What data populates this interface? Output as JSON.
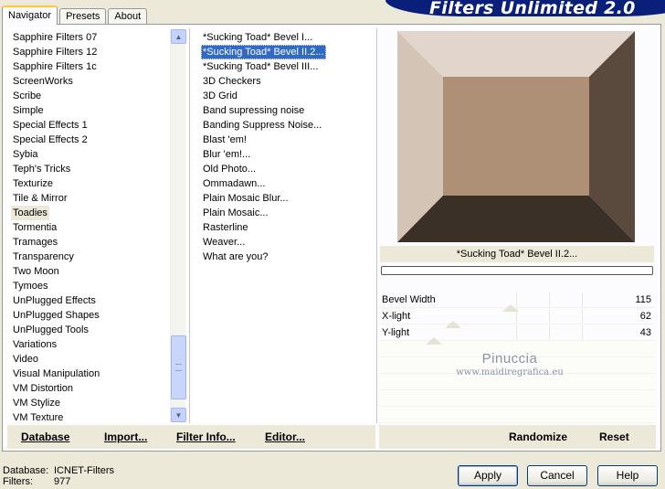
{
  "tabs": [
    "Navigator",
    "Presets",
    "About"
  ],
  "brand": "Filters Unlimited 2.0",
  "categories": [
    "Sapphire Filters 07",
    "Sapphire Filters 12",
    "Sapphire Filters 1c",
    "ScreenWorks",
    "Scribe",
    "Simple",
    "Special Effects 1",
    "Special Effects 2",
    "Sybia",
    "Teph's Tricks",
    "Texturize",
    "Tile & Mirror",
    "Toadies",
    "Tormentia",
    "Tramages",
    "Transparency",
    "Two Moon",
    "Tymoes",
    "UnPlugged Effects",
    "UnPlugged Shapes",
    "UnPlugged Tools",
    "Variations",
    "Video",
    "Visual Manipulation",
    "VM Distortion",
    "VM Stylize",
    "VM Texture"
  ],
  "selected_category": "Toadies",
  "filters": [
    "*Sucking Toad*  Bevel I...",
    "*Sucking Toad*  Bevel II.2...",
    "*Sucking Toad*  Bevel III...",
    "3D Checkers",
    "3D Grid",
    "Band supressing noise",
    "Banding Suppress Noise...",
    "Blast 'em!",
    "Blur 'em!...",
    "Old Photo...",
    "Ommadawn...",
    "Plain Mosaic Blur...",
    "Plain Mosaic...",
    "Rasterline",
    "Weaver...",
    "What are you?"
  ],
  "selected_filter": "*Sucking Toad*  Bevel II.2...",
  "preview": {
    "filter_name": "*Sucking Toad*  Bevel II.2...",
    "colors": {
      "top": "#e2d5cb",
      "left": "#d4c4b6",
      "right": "#5a4a3d",
      "bottom": "#3a3028",
      "center": "#ad9075"
    }
  },
  "params": [
    {
      "label": "Bevel Width",
      "value": "115",
      "fraction": 0.45
    },
    {
      "label": "X-light",
      "value": "62",
      "fraction": 0.24
    },
    {
      "label": "Y-light",
      "value": "43",
      "fraction": 0.17
    }
  ],
  "watermark": {
    "line1": "Pinuccia",
    "line2": "www.maidiregrafica.eu"
  },
  "left_buttons": {
    "database": "Database",
    "import": "Import...",
    "filter_info": "Filter Info...",
    "editor": "Editor..."
  },
  "right_buttons": {
    "randomize": "Randomize",
    "reset": "Reset"
  },
  "status": {
    "database_label": "Database:",
    "database_value": "ICNET-Filters",
    "filters_label": "Filters:",
    "filters_value": "977"
  },
  "dialog_buttons": {
    "apply": "Apply",
    "cancel": "Cancel",
    "help": "Help"
  }
}
